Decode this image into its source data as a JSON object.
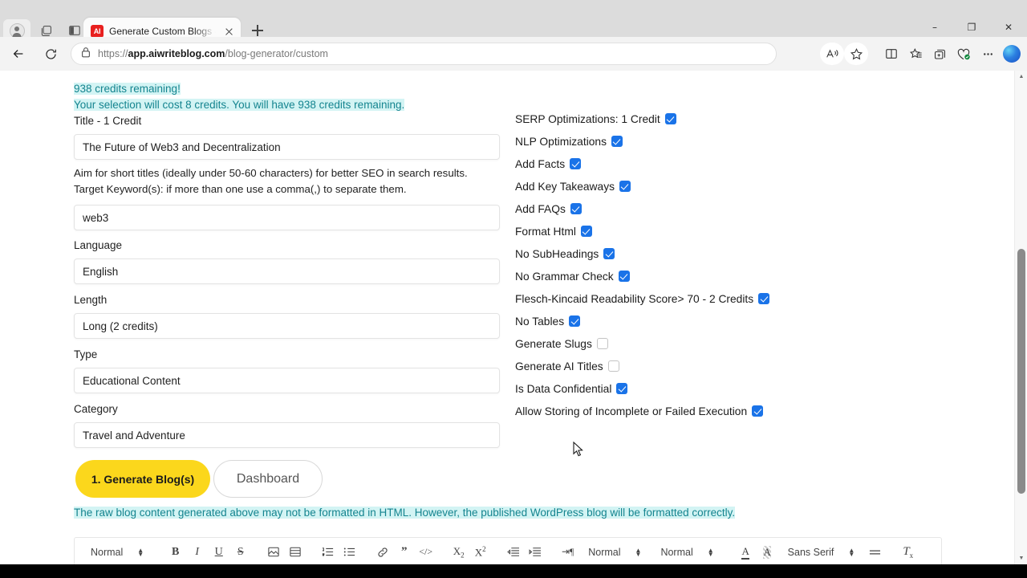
{
  "browser": {
    "profile_icon": "profile-avatar-icon",
    "collections_icon": "collections-icon",
    "split_screen_icon": "split-screen-icon",
    "tab": {
      "favicon_text": "AI",
      "title": "Generate Custom Blogs - AIWrite",
      "close_icon": "close-icon"
    },
    "new_tab_icon": "new-tab-icon",
    "window_controls": {
      "minimize": "–",
      "maximize": "❐",
      "close": "✕"
    },
    "back_icon": "back-arrow-icon",
    "reload_icon": "reload-icon",
    "lock_icon": "lock-icon",
    "url_prefix": "https://",
    "url_host": "app.aiwriteblog.com",
    "url_path": "/blog-generator/custom",
    "toolbar_icons": [
      "read-aloud-icon",
      "favorite-star-icon",
      "split-screen-icon",
      "favorites-list-icon",
      "collections-add-icon",
      "browser-essentials-icon",
      "settings-more-icon",
      "copilot-icon"
    ]
  },
  "page": {
    "credits": {
      "remaining_line": "938 credits remaining!",
      "cost_line": "Your selection will cost 8 credits. You will have 938 credits remaining."
    },
    "fields": [
      {
        "label": "Title - 1 Credit",
        "value": "The Future of Web3 and Decentralization",
        "name": "title"
      },
      {
        "label": "Target Keyword(s)",
        "value": "web3",
        "name": "keywords"
      },
      {
        "label": "Language",
        "value": "English",
        "name": "language"
      },
      {
        "label": "Length",
        "value": "Long (2 credits)",
        "name": "length"
      },
      {
        "label": "Type",
        "value": "Educational Content",
        "name": "type"
      },
      {
        "label": "Category",
        "value": "Travel and Adventure",
        "name": "category"
      }
    ],
    "hints": {
      "title_hint": "Aim for short titles (ideally under 50-60 characters) for better SEO in search results.",
      "keyword_hint": "Target Keyword(s): if more than one use a comma(,) to separate them."
    },
    "options": [
      {
        "label": "SERP Optimizations: 1 Credit",
        "checked": true
      },
      {
        "label": "NLP Optimizations",
        "checked": true
      },
      {
        "label": "Add Facts",
        "checked": true
      },
      {
        "label": "Add Key Takeaways",
        "checked": true
      },
      {
        "label": "Add FAQs",
        "checked": true
      },
      {
        "label": "Format Html",
        "checked": true
      },
      {
        "label": "No SubHeadings",
        "checked": true
      },
      {
        "label": "No Grammar Check",
        "checked": true
      },
      {
        "label": "Flesch-Kincaid Readability Score> 70 - 2 Credits",
        "checked": true
      },
      {
        "label": "No Tables",
        "checked": true
      },
      {
        "label": "Generate Slugs",
        "checked": false
      },
      {
        "label": "Generate AI Titles",
        "checked": false
      },
      {
        "label": "Is Data Confidential",
        "checked": true
      },
      {
        "label": "Allow Storing of Incomplete or Failed Execution",
        "checked": true
      }
    ],
    "buttons": {
      "generate": "1. Generate Blog(s)",
      "dashboard": "Dashboard"
    },
    "note": "The raw blog content generated above may not be formatted in HTML. However, the published WordPress blog will be formatted correctly."
  },
  "editor_toolbar": {
    "header_select": "Normal",
    "size_select": "Normal",
    "line_height_select": "Normal",
    "font_select": "Sans Serif",
    "buttons": [
      "bold",
      "italic",
      "underline",
      "strikethrough",
      "image",
      "video",
      "ordered-list",
      "bullet-list",
      "link",
      "blockquote",
      "code-block",
      "subscript",
      "superscript",
      "outdent",
      "indent",
      "direction",
      "align",
      "clear-format"
    ]
  },
  "colors": {
    "accent_yellow": "#fbd71c",
    "checkbox_blue": "#1a73e8",
    "highlight_cyan": "#d3f4f4",
    "teal_text": "#14848f"
  }
}
